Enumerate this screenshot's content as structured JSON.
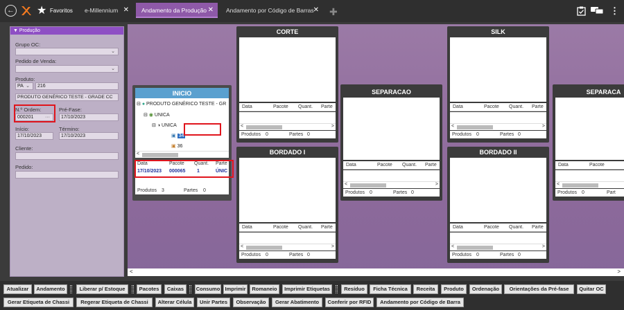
{
  "topbar": {
    "favoritos": "Favoritos",
    "tabs": [
      {
        "label": "e-Millennium"
      },
      {
        "label": "Andamento da Produção"
      },
      {
        "label": "Andamento por Código de Barras"
      }
    ]
  },
  "left_panel": {
    "header": "Produção",
    "grupo_oc_label": "Grupo OC:",
    "grupo_oc_value": "",
    "pedido_venda_label": "Pedido de Venda:",
    "pedido_venda_value": "",
    "produto_label": "Produto:",
    "produto_prefix": "PA",
    "produto_code": "216",
    "produto_desc": "PRODUTO GENÉRICO TESTE - GRADE CC",
    "ordem_label": "N.º Ordem:",
    "ordem_value": "000201",
    "pre_fase_label": "Pré-Fase:",
    "pre_fase_value": "17/10/2023",
    "inicio_label": "Início:",
    "inicio_value": "17/10/2023",
    "termino_label": "Término:",
    "termino_value": "17/10/2023",
    "cliente_label": "Cliente:",
    "cliente_value": "",
    "pedido_label": "Pedido:",
    "pedido_value": ""
  },
  "columns": {
    "data": "Data",
    "pacote": "Pacote",
    "quant": "Quant.",
    "parte": "Parte"
  },
  "footer": {
    "produtos": "Produtos",
    "partes": "Partes"
  },
  "stages": {
    "inicio": {
      "title": "INICIO",
      "tree": {
        "product": "PRODUTO GENÉRICO TESTE - GR",
        "level1": "UNICA",
        "level2": "UNICA",
        "item1": "34",
        "item2": "36"
      },
      "row": {
        "data": "17/10/2023",
        "pacote": "000065",
        "quant": "1",
        "parte": "ÚNIC"
      },
      "produtos": "3",
      "partes": "0"
    },
    "corte": {
      "title": "CORTE",
      "produtos": "0",
      "partes": "0"
    },
    "bordado1": {
      "title": "BORDADO I",
      "produtos": "0",
      "partes": "0"
    },
    "separacao": {
      "title": "SEPARACAO",
      "produtos": "0",
      "partes": "0"
    },
    "silk": {
      "title": "SILK",
      "produtos": "0",
      "partes": "0"
    },
    "bordado2": {
      "title": "BORDADO II",
      "produtos": "0",
      "partes": "0"
    },
    "separaca_cut": {
      "title": "SEPARACA",
      "produtos": "0",
      "partes": "0",
      "partes_cut": "Part"
    }
  },
  "toolbar_row1": [
    "Atualizar",
    "Andamento",
    "Liberar p/ Estoque",
    "Pacotes",
    "Caixas",
    "Consumo",
    "Imprimir",
    "Romaneio",
    "Imprimir Etiquetas",
    "Resíduo",
    "Ficha Técnica",
    "Receita",
    "Produto",
    "Ordenação",
    "Orientações da Pré-fase",
    "Quitar OC"
  ],
  "toolbar_row2": [
    "Gerar Etiqueta de Chassi",
    "Regerar Etiqueta de Chassi",
    "Alterar Célula",
    "Unir Partes",
    "Observação",
    "Gerar Abatimento",
    "Conferir por RFID",
    "Andamento por Código de Barra"
  ],
  "colors": {
    "accent": "#8e59a8",
    "panel_header": "#8e4fc4",
    "inicio_header": "#5aa0cf",
    "highlight": "#e0141c"
  },
  "icons": [
    "back-arrow-icon",
    "logo-icon",
    "star-icon",
    "close-icon",
    "plus-icon",
    "clipboard-icon",
    "chat-icon",
    "more-icon",
    "globe-icon",
    "hanger-icon",
    "triangle-down-icon"
  ]
}
